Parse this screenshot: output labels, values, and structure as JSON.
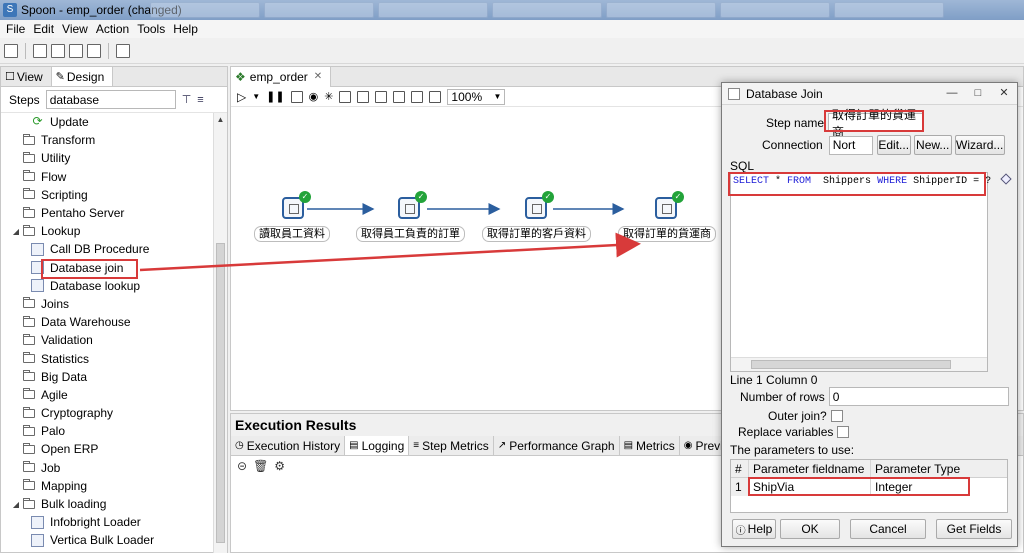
{
  "window": {
    "title": "Spoon - emp_order (changed)"
  },
  "menu": [
    "File",
    "Edit",
    "View",
    "Action",
    "Tools",
    "Help"
  ],
  "left_panel": {
    "tabs": [
      "View",
      "Design"
    ],
    "steps_label": "Steps",
    "search_value": "database",
    "tree": [
      {
        "label": "Update",
        "kind": "step",
        "indent": 2
      },
      {
        "label": "Transform",
        "kind": "folder",
        "indent": 1
      },
      {
        "label": "Utility",
        "kind": "folder",
        "indent": 1
      },
      {
        "label": "Flow",
        "kind": "folder",
        "indent": 1
      },
      {
        "label": "Scripting",
        "kind": "folder",
        "indent": 1
      },
      {
        "label": "Pentaho Server",
        "kind": "folder",
        "indent": 1
      },
      {
        "label": "Lookup",
        "kind": "folder-open",
        "indent": 1
      },
      {
        "label": "Call DB Procedure",
        "kind": "step",
        "indent": 2
      },
      {
        "label": "Database join",
        "kind": "step",
        "indent": 2
      },
      {
        "label": "Database lookup",
        "kind": "step",
        "indent": 2
      },
      {
        "label": "Joins",
        "kind": "folder",
        "indent": 1
      },
      {
        "label": "Data Warehouse",
        "kind": "folder",
        "indent": 1
      },
      {
        "label": "Validation",
        "kind": "folder",
        "indent": 1
      },
      {
        "label": "Statistics",
        "kind": "folder",
        "indent": 1
      },
      {
        "label": "Big Data",
        "kind": "folder",
        "indent": 1
      },
      {
        "label": "Agile",
        "kind": "folder",
        "indent": 1
      },
      {
        "label": "Cryptography",
        "kind": "folder",
        "indent": 1
      },
      {
        "label": "Palo",
        "kind": "folder",
        "indent": 1
      },
      {
        "label": "Open ERP",
        "kind": "folder",
        "indent": 1
      },
      {
        "label": "Job",
        "kind": "folder",
        "indent": 1
      },
      {
        "label": "Mapping",
        "kind": "folder",
        "indent": 1
      },
      {
        "label": "Bulk loading",
        "kind": "folder-open",
        "indent": 1
      },
      {
        "label": "Infobright Loader",
        "kind": "step",
        "indent": 2
      },
      {
        "label": "Vertica Bulk Loader",
        "kind": "step",
        "indent": 2
      }
    ]
  },
  "canvas": {
    "tab": "emp_order",
    "zoom": "100%",
    "steps": [
      "讀取員工資料",
      "取得員工負責的訂單",
      "取得訂單的客戶資料",
      "取得訂單的貨運商"
    ]
  },
  "execution": {
    "title": "Execution Results",
    "tabs": [
      "Execution History",
      "Logging",
      "Step Metrics",
      "Performance Graph",
      "Metrics",
      "Previ"
    ]
  },
  "dialog": {
    "title": "Database Join",
    "step_name_label": "Step name",
    "step_name_value": "取得訂單的貨運商",
    "connection_label": "Connection",
    "connection_value": "Nort",
    "edit_button": "Edit...",
    "new_button": "New...",
    "wizard_button": "Wizard...",
    "sql_label": "SQL",
    "sql_parts": {
      "select": "SELECT",
      "star": " * ",
      "from": "FROM",
      "table": "  Shippers ",
      "where": "WHERE",
      "cond": " ShipperID = ?"
    },
    "cursor_pos": "Line 1 Column 0",
    "rows_label": "Number of rows",
    "rows_value": "0",
    "outer_join_label": "Outer join?",
    "replace_vars_label": "Replace variables",
    "params_label": "The parameters to use:",
    "param_headers": [
      "#",
      "Parameter fieldname",
      "Parameter Type"
    ],
    "params": [
      {
        "n": "1",
        "field": "ShipVia",
        "type": "Integer"
      }
    ],
    "help_button": "Help",
    "ok_button": "OK",
    "cancel_button": "Cancel",
    "get_fields_button": "Get Fields"
  },
  "colors": {
    "accent_red": "#d83a3a",
    "node_border": "#2b5e9e",
    "ok_green": "#23a33a",
    "sql_keyword": "#1a1ad6"
  }
}
